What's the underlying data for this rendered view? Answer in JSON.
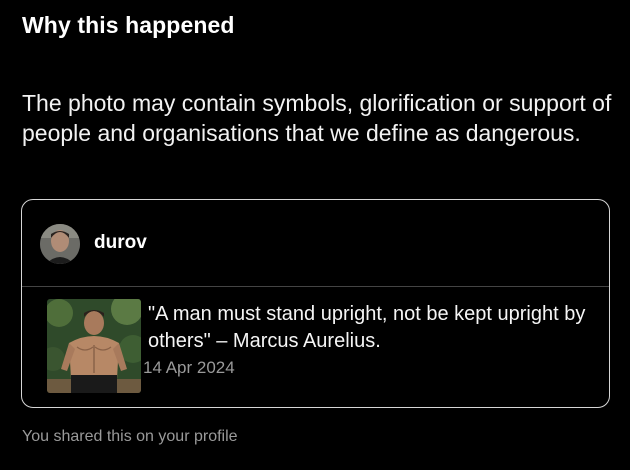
{
  "title": "Why this happened",
  "explanation": "The photo may contain symbols, glorification or support of people and organisations that we define as dangerous.",
  "post": {
    "username": "durov",
    "caption": "\"A man must stand upright, not be kept upright by others\" – Marcus Aurelius.",
    "date": "14 Apr 2024"
  },
  "footer_note": "You shared this on your profile",
  "colors": {
    "background": "#000000",
    "text": "#f5f5f5",
    "muted": "#9a9a9a",
    "card_border": "#d6d6d6"
  }
}
